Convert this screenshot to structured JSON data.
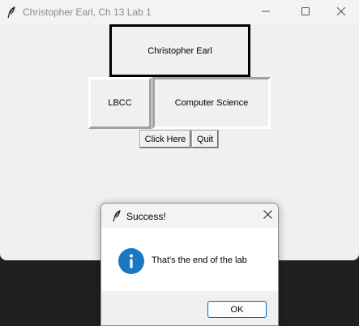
{
  "window": {
    "title": "Christopher Earl, Ch 13 Lab 1",
    "icon": "feather-icon",
    "controls": [
      "minimize-icon",
      "maximize-icon",
      "close-icon"
    ]
  },
  "labels": {
    "name": "Christopher Earl",
    "school": "LBCC",
    "major": "Computer Science"
  },
  "buttons": {
    "click_here": "Click Here",
    "quit": "Quit"
  },
  "dialog": {
    "title": "Success!",
    "icon": "info-icon",
    "message": "That's the end of the lab",
    "ok_label": "OK"
  },
  "colors": {
    "info_blue": "#1a78c2",
    "ok_border": "#0067c0",
    "window_bg": "#f0f0f0"
  }
}
